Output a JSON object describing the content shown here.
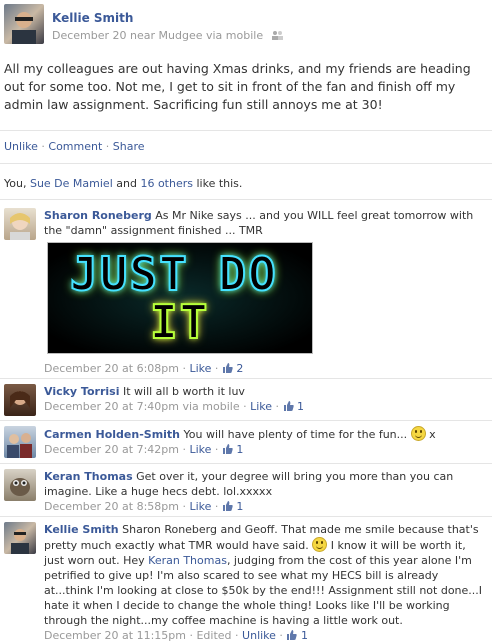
{
  "post": {
    "author": "Kellie Smith",
    "meta": "December 20 near Mudgee via mobile",
    "text": "All my colleagues are out having Xmas drinks, and my friends are heading out for some too. Not me, I get to sit in front of the fan and finish off my admin law assignment. Sacrificing fun still annoys me at 30!",
    "actions": {
      "unlike": "Unlike",
      "comment": "Comment",
      "share": "Share",
      "dot": "·"
    },
    "likes": {
      "you": "You",
      "comma": ",",
      "person": "Sue De Mamiel",
      "and": "and",
      "others": "16 others",
      "suffix": "like this."
    }
  },
  "image_text": {
    "line1": "JUST DO",
    "line2": "IT"
  },
  "comments": [
    {
      "name": "Sharon Roneberg",
      "text": "As Mr Nike says ... and you WILL feel great tomorrow with the \"damn\" assignment finished ... TMR",
      "time": "December 20 at 6:08pm",
      "like": "Like",
      "count": "2"
    },
    {
      "name": "Vicky Torrisi",
      "text": "It will all b worth it luv",
      "time": "December 20 at 7:40pm via mobile",
      "like": "Like",
      "count": "1"
    },
    {
      "name": "Carmen Holden-Smith",
      "text": "You will have plenty of time for the fun...",
      "text_after": "x",
      "time": "December 20 at 7:42pm",
      "like": "Like",
      "count": "1"
    },
    {
      "name": "Keran Thomas",
      "text": "Get over it, your degree will bring you more than you can imagine. Like a huge hecs debt. lol.xxxxx",
      "time": "December 20 at 8:58pm",
      "like": "Like",
      "count": "1"
    },
    {
      "name": "Kellie Smith",
      "text_a": "Sharon Roneberg and Geoff. That made me smile because that's pretty much exactly what TMR would have said.",
      "text_b": "I know it will be worth it, just worn out. Hey",
      "mention": "Keran Thomas",
      "text_c": ", judging from the cost of this year alone I'm petrified to give up! I'm also scared to see what my HECS bill is already at...think I'm looking at close to $50k by the end!!! Assignment still not done...I hate it when I decide to change the whole thing! Looks like I'll be working through the night...my coffee machine is having a little work out.",
      "time": "December 20 at 11:15pm",
      "edited": "Edited",
      "unlike": "Unlike",
      "count": "1"
    }
  ],
  "colors": {
    "link": "#3b5998",
    "meta": "#999999",
    "text": "#333333"
  }
}
